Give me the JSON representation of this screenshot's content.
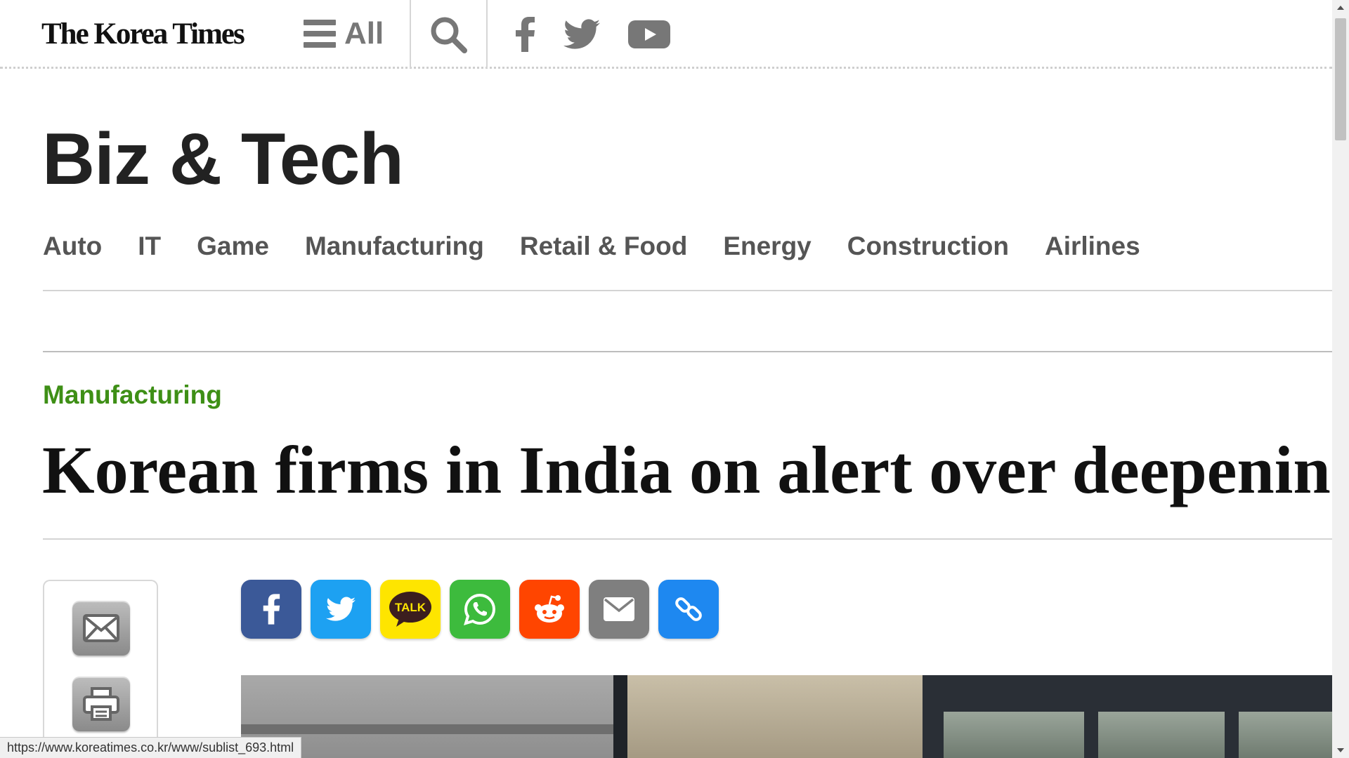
{
  "header": {
    "logo": "The Korea Times",
    "menu_label": "All",
    "icons": [
      "hamburger-icon",
      "search-icon",
      "facebook-icon",
      "twitter-icon",
      "youtube-icon"
    ]
  },
  "section": {
    "title": "Biz & Tech",
    "subnav": [
      "Auto",
      "IT",
      "Game",
      "Manufacturing",
      "Retail & Food",
      "Energy",
      "Construction",
      "Airlines"
    ]
  },
  "article": {
    "category": "Manufacturing",
    "headline": "Korean firms in India on alert over deepening"
  },
  "tools": [
    "email-icon",
    "print-icon"
  ],
  "share": {
    "buttons": [
      {
        "name": "facebook",
        "color": "#3b5998"
      },
      {
        "name": "twitter",
        "color": "#1da1f2"
      },
      {
        "name": "kakaotalk",
        "color": "#fee500",
        "label": "TALK"
      },
      {
        "name": "whatsapp",
        "color": "#3dbb3d"
      },
      {
        "name": "reddit",
        "color": "#ff4500"
      },
      {
        "name": "email",
        "color": "#7f7f7f"
      },
      {
        "name": "copy-link",
        "color": "#1e88f0"
      }
    ]
  },
  "status_bar": {
    "url": "https://www.koreatimes.co.kr/www/sublist_693.html"
  },
  "colors": {
    "category_green": "#3e8f16",
    "nav_gray": "#555555"
  }
}
